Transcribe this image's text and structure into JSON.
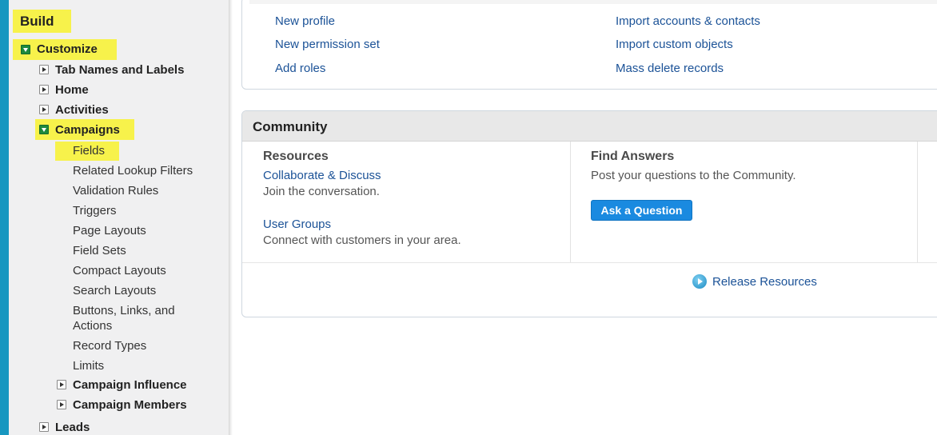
{
  "sidebar": {
    "build_label": "Build",
    "customize_label": "Customize",
    "items": {
      "tab_names": "Tab Names and Labels",
      "home": "Home",
      "activities": "Activities",
      "campaigns": "Campaigns",
      "fields": "Fields",
      "related_lookup_filters": "Related Lookup Filters",
      "validation_rules": "Validation Rules",
      "triggers": "Triggers",
      "page_layouts": "Page Layouts",
      "field_sets": "Field Sets",
      "compact_layouts": "Compact Layouts",
      "search_layouts": "Search Layouts",
      "buttons_links_1": "Buttons, Links, and",
      "buttons_links_2": "Actions",
      "record_types": "Record Types",
      "limits": "Limits",
      "campaign_influence": "Campaign Influence",
      "campaign_members": "Campaign Members",
      "leads": "Leads"
    },
    "highlight_color": "#f7f24b"
  },
  "quick_links": {
    "left": [
      "New profile",
      "New permission set",
      "Add roles"
    ],
    "right": [
      "Import accounts & contacts",
      "Import custom objects",
      "Mass delete records"
    ]
  },
  "community": {
    "title": "Community",
    "resources": {
      "heading": "Resources",
      "link1": "Collaborate & Discuss",
      "desc1": "Join the conversation.",
      "link2": "User Groups",
      "desc2": "Connect with customers in your area."
    },
    "answers": {
      "heading": "Find Answers",
      "desc": "Post your questions to the Community.",
      "button": "Ask a Question"
    },
    "release_link": "Release Resources"
  },
  "colors": {
    "link": "#1b5297",
    "button": "#1a8ae0",
    "accent_edge": "#1797c0"
  }
}
